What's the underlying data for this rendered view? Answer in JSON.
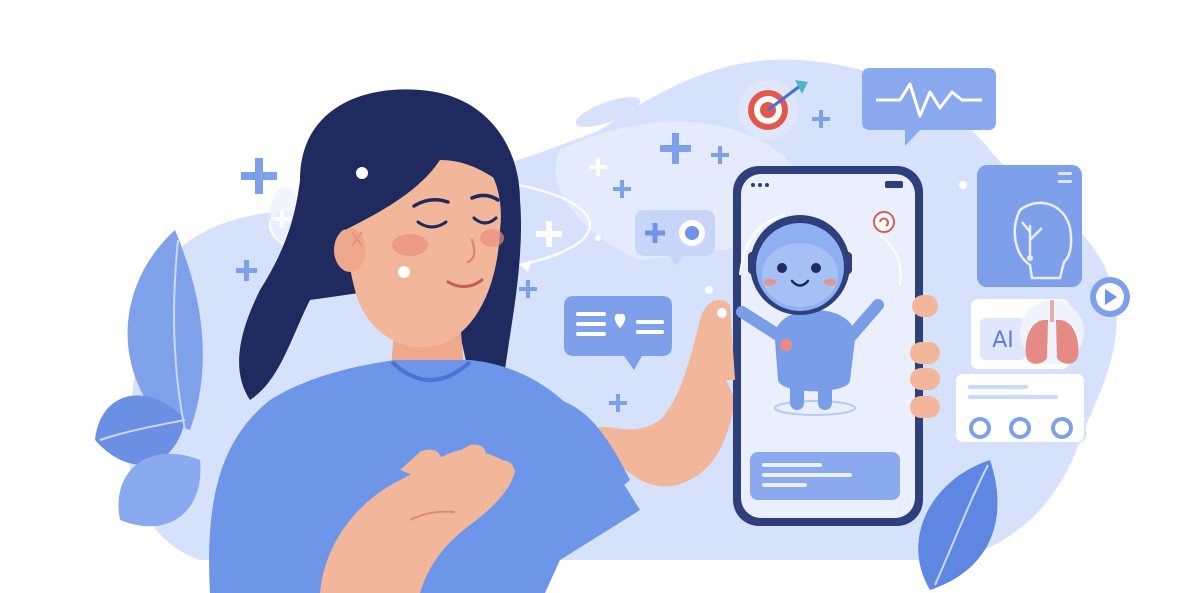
{
  "illustration": {
    "subject": "woman-with-hand-on-chest-holding-smartphone",
    "palette": {
      "background_blob": "#cfdcf8",
      "accent_blue": "#6f93e6",
      "deep_blue": "#4a6fd0",
      "hair": "#1f2a5e",
      "skin": "#f2b79a",
      "shirt": "#6d95e8",
      "target_red": "#e2584f"
    },
    "icons": [
      "sparkle-plus-icon",
      "target-dart-icon",
      "heartbeat-chat-icon",
      "heart-message-icon",
      "robot-chat-icon",
      "head-mind-icon",
      "play-button-icon",
      "lungs-icon",
      "feedback-rating-icon",
      "leaf-icon"
    ],
    "ai_badge_text": "AI"
  }
}
